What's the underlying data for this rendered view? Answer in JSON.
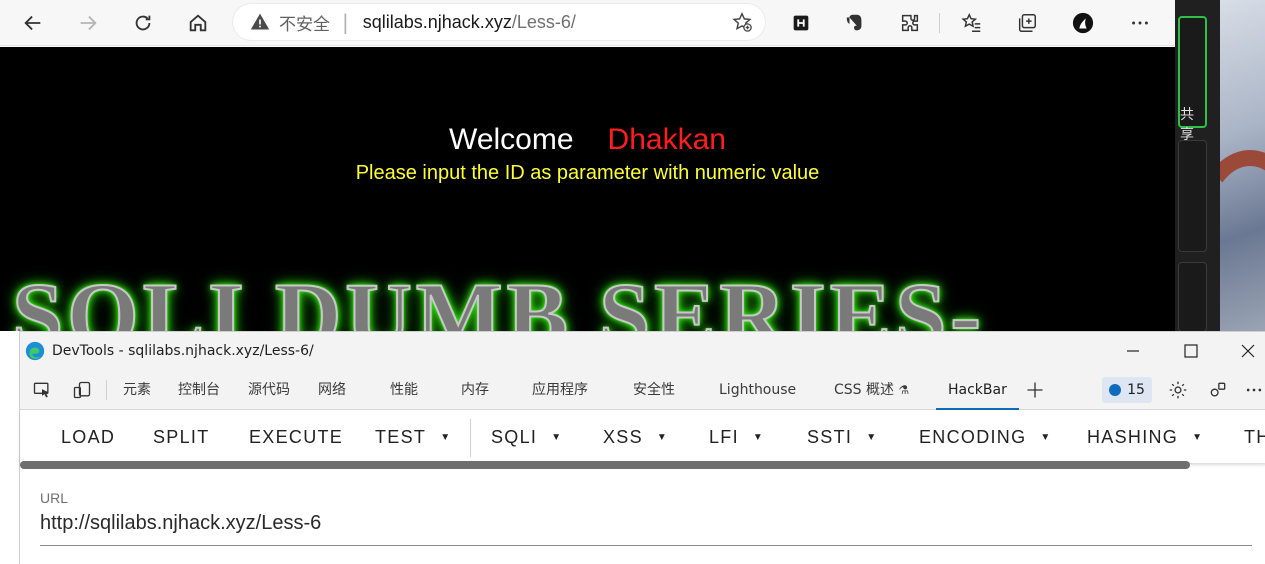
{
  "browser": {
    "address": {
      "security_label": "不安全",
      "host": "sqlilabs.njhack.xyz",
      "path": "/Less-6/"
    }
  },
  "page": {
    "welcome": "Welcome",
    "user": "Dhakkan",
    "instruction": "Please input the ID as parameter with numeric value",
    "banner": "SQLI DUMB SERIES-"
  },
  "side_panel": {
    "card_text": "共享"
  },
  "devtools": {
    "title": "DevTools - sqlilabs.njhack.xyz/Less-6/",
    "tabs": [
      {
        "label": "元素"
      },
      {
        "label": "控制台"
      },
      {
        "label": "源代码"
      },
      {
        "label": "网络"
      },
      {
        "label": "性能"
      },
      {
        "label": "内存"
      },
      {
        "label": "应用程序"
      },
      {
        "label": "安全性"
      },
      {
        "label": "Lighthouse"
      },
      {
        "label": "CSS 概述"
      },
      {
        "label": "HackBar"
      }
    ],
    "active_tab": "HackBar",
    "issues_count": "15",
    "hackbar": {
      "buttons": [
        {
          "label": "LOAD",
          "dropdown": false
        },
        {
          "label": "SPLIT",
          "dropdown": false
        },
        {
          "label": "EXECUTE",
          "dropdown": false
        },
        {
          "label": "TEST",
          "dropdown": true
        },
        {
          "label": "SQLI",
          "dropdown": true
        },
        {
          "label": "XSS",
          "dropdown": true
        },
        {
          "label": "LFI",
          "dropdown": true
        },
        {
          "label": "SSTI",
          "dropdown": true
        },
        {
          "label": "ENCODING",
          "dropdown": true
        },
        {
          "label": "HASHING",
          "dropdown": true
        },
        {
          "label": "TH",
          "dropdown": false
        }
      ],
      "url_label": "URL",
      "url_value": "http://sqlilabs.njhack.xyz/Less-6"
    }
  }
}
